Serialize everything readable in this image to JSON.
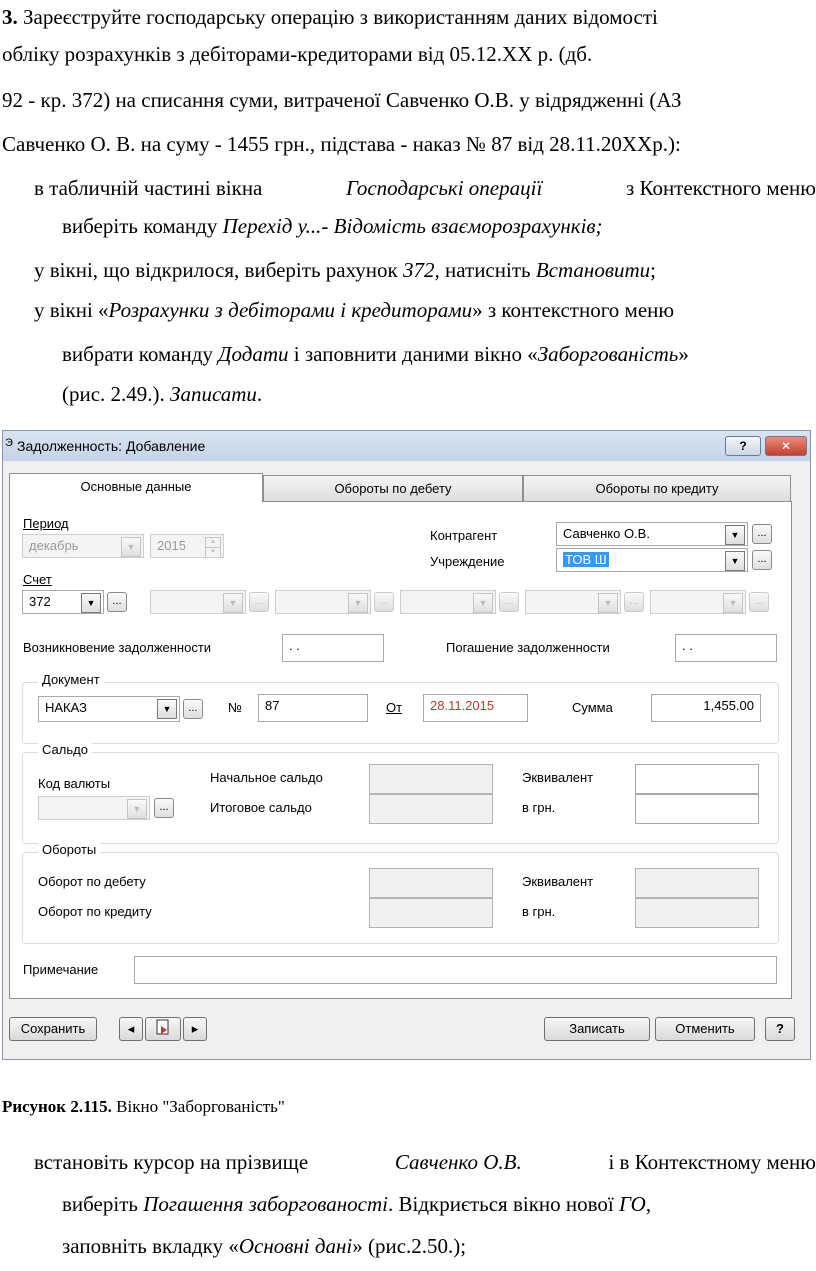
{
  "doc": {
    "task_number": "3.",
    "intro_line1": "Зареєструйте господарську операцію з використанням даних відомості",
    "intro_line2": "обліку розрахунків з дебіторами-кредиторами від 05.12.ХХ р. (дб.",
    "intro_line3": "92 - кр. 372) на списання суми, витраченої Савченко О.В. у відрядженні (АЗ",
    "intro_line4": "Савченко О. В. на суму - 1455 грн., підстава - наказ № 87 від 28.11.20ХХр.):",
    "b1_start": "в табличній частині вікна",
    "b1_italic": "Господарські операції",
    "b1_end": "з Контекстного меню",
    "b1_line2_start": "виберіть команду",
    "b1_line2_italic": "Перехід у...- Відомість взаєморозрахунків;",
    "b2_start": "у вікні, що відкрилося, виберіть рахунок",
    "b2_italic1": "372,",
    "b2_mid": "натисніть",
    "b2_italic2": "Встановити",
    "b2_end": ";",
    "b3_start": "у вікні «",
    "b3_italic": "Розрахунки з дебіторами і кредиторами",
    "b3_end": "» з контекстного меню",
    "b3_line2_start": "вибрати команду",
    "b3_line2_italic1": "Додати",
    "b3_line2_mid": "і заповнити даними вікно «",
    "b3_line2_italic2": "Заборгованість",
    "b3_line2_end": "»",
    "b3_line3_start": "(рис. 2.49.).",
    "b3_line3_italic": "Записати",
    "b3_line3_end": ".",
    "caption_bold": "Рисунок 2.115.",
    "caption_text": "Вікно \"Заборгованість\"",
    "b4_start": "встановіть курсор на прізвище",
    "b4_italic": "Савченко О.В.",
    "b4_end": "і в Контекстному меню",
    "b4_line2_start": "виберіть",
    "b4_line2_italic1": "Погашення заборгованості",
    "b4_line2_mid": ". Відкриється вікно нової",
    "b4_line2_italic2": "ГО",
    "b4_line2_end": ",",
    "b4_line3_start": "заповніть вкладку «",
    "b4_line3_italic": "Основні дані",
    "b4_line3_end": "» (рис.2.50.);"
  },
  "window": {
    "title": "Задолженность: Добавление",
    "title_icon": "Э",
    "help_btn": "?",
    "close_btn": "✕",
    "tabs": [
      "Основные данные",
      "Обороты по дебету",
      "Обороты по кредиту"
    ],
    "period_label": "Период",
    "period_month": "декабрь",
    "period_year": "2015",
    "account_label": "Счет",
    "account_value": "372",
    "counterparty_label": "Контрагент",
    "counterparty_value": "Савченко О.В.",
    "institution_label": "Учреждение",
    "institution_value": "ТОВ Ш",
    "debt_origin_label": "Возникновение задолженности",
    "debt_origin_value": ". .",
    "debt_repay_label": "Погашение задолженности",
    "debt_repay_value": ". .",
    "doc_group": "Документ",
    "doc_type": "НАКАЗ",
    "num_label": "№",
    "num_value": "87",
    "from_label": "От",
    "date_value": "28.11.2015",
    "sum_label": "Сумма",
    "sum_value": "1,455.00",
    "saldo_group": "Сальдо",
    "currency_label": "Код валюты",
    "opening_label": "Начальное сальдо",
    "closing_label": "Итоговое сальдо",
    "equiv_label": "Эквивалент",
    "uah_label": "в грн.",
    "turnover_group": "Обороты",
    "turn_debit_label": "Оборот по дебету",
    "turn_credit_label": "Оборот по кредиту",
    "equiv_label2": "Эквивалент",
    "uah_label2": "в грн.",
    "note_label": "Примечание",
    "save_btn": "Сохранить",
    "record_btn": "Записать",
    "cancel_btn": "Отменить",
    "help_btn2": "?",
    "dropdown_arrow": "▼",
    "ellipsis": "...",
    "nav_prev": "◂",
    "nav_next": "▸"
  }
}
